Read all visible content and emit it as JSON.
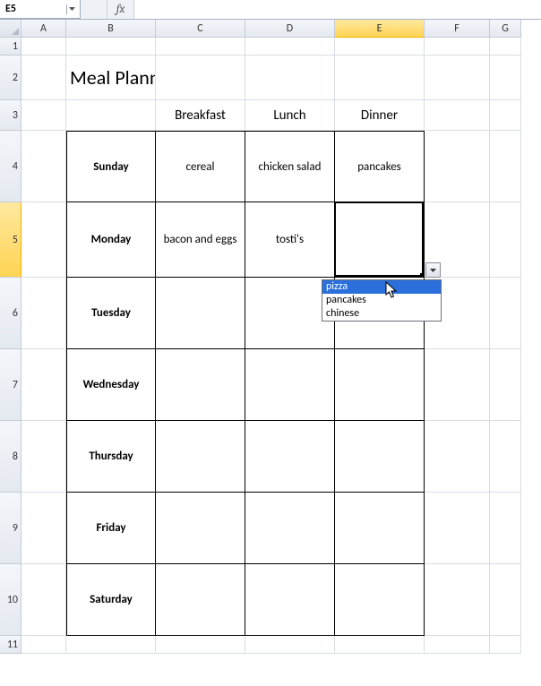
{
  "namebox": {
    "ref": "E5"
  },
  "formula": {
    "value": ""
  },
  "fx_label": "fx",
  "columns": [
    "A",
    "B",
    "C",
    "D",
    "E",
    "F",
    "G"
  ],
  "rows": [
    "1",
    "2",
    "3",
    "4",
    "5",
    "6",
    "7",
    "8",
    "9",
    "10",
    "11"
  ],
  "selected": {
    "col": "E",
    "row": "5"
  },
  "title": "Meal Planner",
  "headers": {
    "breakfast": "Breakfast",
    "lunch": "Lunch",
    "dinner": "Dinner"
  },
  "days": {
    "sun": "Sunday",
    "mon": "Monday",
    "tue": "Tuesday",
    "wed": "Wednesday",
    "thu": "Thursday",
    "fri": "Friday",
    "sat": "Saturday"
  },
  "meals": {
    "sun": {
      "breakfast": "cereal",
      "lunch": "chicken salad",
      "dinner": "pancakes"
    },
    "mon": {
      "breakfast": "bacon and eggs",
      "lunch": "tosti's",
      "dinner": ""
    },
    "tue": {
      "breakfast": "",
      "lunch": "",
      "dinner": ""
    },
    "wed": {
      "breakfast": "",
      "lunch": "",
      "dinner": ""
    },
    "thu": {
      "breakfast": "",
      "lunch": "",
      "dinner": ""
    },
    "fri": {
      "breakfast": "",
      "lunch": "",
      "dinner": ""
    },
    "sat": {
      "breakfast": "",
      "lunch": "",
      "dinner": ""
    }
  },
  "dropdown": {
    "options": [
      "pizza",
      "pancakes",
      "chinese"
    ],
    "highlighted": 0
  }
}
